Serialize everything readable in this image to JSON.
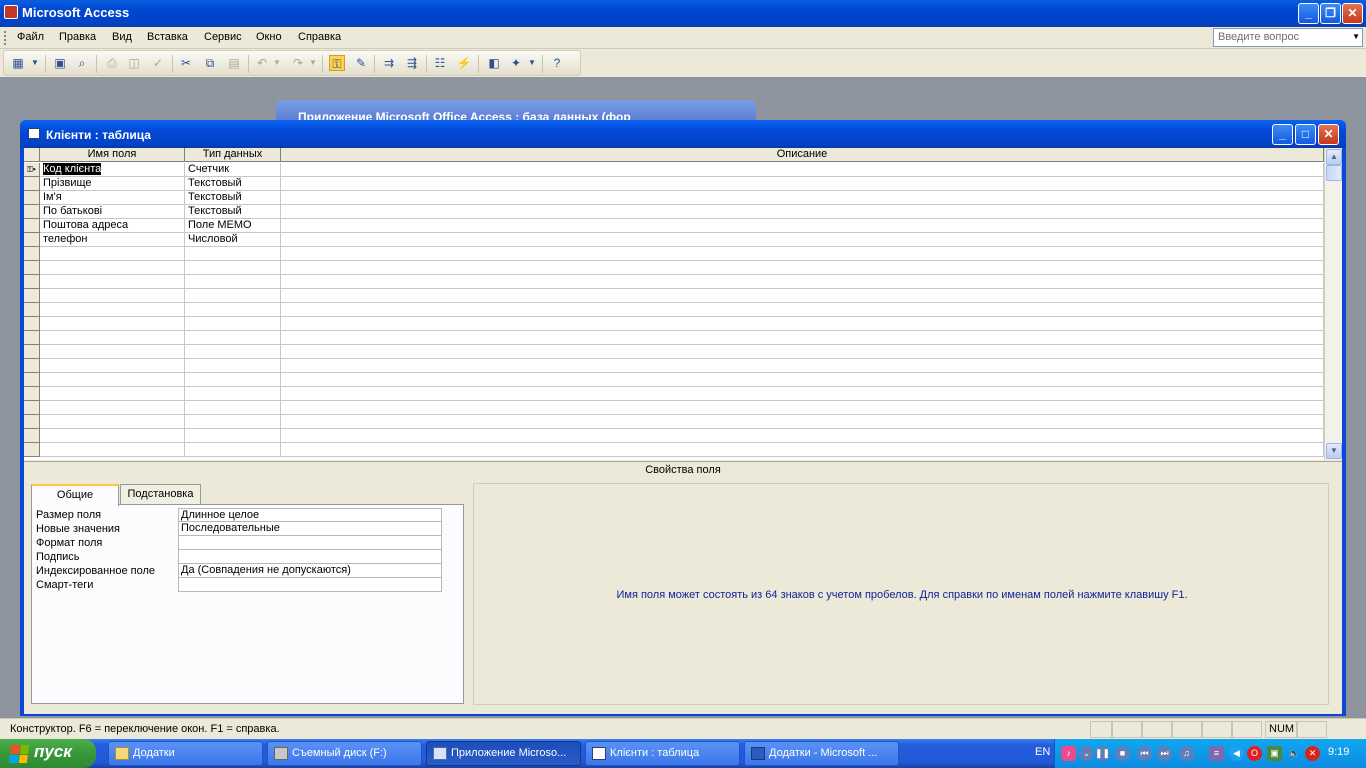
{
  "app": {
    "title": "Microsoft Access",
    "buttons": {
      "minimize": "_",
      "restore": "❐",
      "close": "✕"
    }
  },
  "menu": {
    "items": [
      "Файл",
      "Правка",
      "Вид",
      "Вставка",
      "Сервис",
      "Окно",
      "Справка"
    ],
    "help_placeholder": "Введите вопрос"
  },
  "toolbar": {
    "icons": [
      "view-design-icon",
      "view-dropdown-icon",
      "save-icon",
      "search-icon",
      "print-icon",
      "print-preview-icon",
      "spelling-icon",
      "cut-icon",
      "copy-icon",
      "paste-icon",
      "undo-icon",
      "undo-dropdown-icon",
      "redo-icon",
      "redo-dropdown-icon",
      "primary-key-icon",
      "builder-icon",
      "insert-rows-icon",
      "delete-rows-icon",
      "properties-icon",
      "indexes-icon",
      "database-window-icon",
      "new-object-icon",
      "new-object-dropdown-icon",
      "help-icon"
    ]
  },
  "bg_window": {
    "title": "Приложение Microsoft Office Access : база данных (фор"
  },
  "table_window": {
    "title": "Клієнти : таблица",
    "columns": [
      "Имя поля",
      "Тип данных",
      "Описание"
    ],
    "rows": [
      {
        "name": "Код клієнта",
        "type": "Счетчик",
        "desc": ""
      },
      {
        "name": "Прізвище",
        "type": "Текстовый",
        "desc": ""
      },
      {
        "name": "Ім'я",
        "type": "Текстовый",
        "desc": ""
      },
      {
        "name": "По батькові",
        "type": "Текстовый",
        "desc": ""
      },
      {
        "name": "Поштова адреса",
        "type": "Поле MEMO",
        "desc": ""
      },
      {
        "name": "телефон",
        "type": "Числовой",
        "desc": ""
      }
    ],
    "empty_rows": 15,
    "properties_caption": "Свойства поля",
    "tabs": [
      "Общие",
      "Подстановка"
    ],
    "properties": [
      {
        "label": "Размер поля",
        "value": "Длинное целое"
      },
      {
        "label": "Новые значения",
        "value": "Последовательные"
      },
      {
        "label": "Формат поля",
        "value": ""
      },
      {
        "label": "Подпись",
        "value": ""
      },
      {
        "label": "Индексированное поле",
        "value": "Да (Совпадения не допускаются)"
      },
      {
        "label": "Смарт-теги",
        "value": ""
      }
    ],
    "hint": "Имя поля может состоять из 64 знаков с учетом пробелов.  Для справки по именам полей нажмите клавишу F1."
  },
  "statusbar": {
    "message": "Конструктор.  F6 = переключение окон.  F1 = справка.",
    "num": "NUM"
  },
  "taskbar": {
    "start": "пуск",
    "tasks": [
      {
        "label": "Додатки",
        "active": false
      },
      {
        "label": "Съемный диск (F:)",
        "active": false
      },
      {
        "label": "Приложение Microso...",
        "active": true
      },
      {
        "label": "Клієнти : таблица",
        "active": false
      },
      {
        "label": "Додатки - Microsoft ...",
        "active": false
      }
    ],
    "lang": "EN",
    "clock": "9:19"
  }
}
